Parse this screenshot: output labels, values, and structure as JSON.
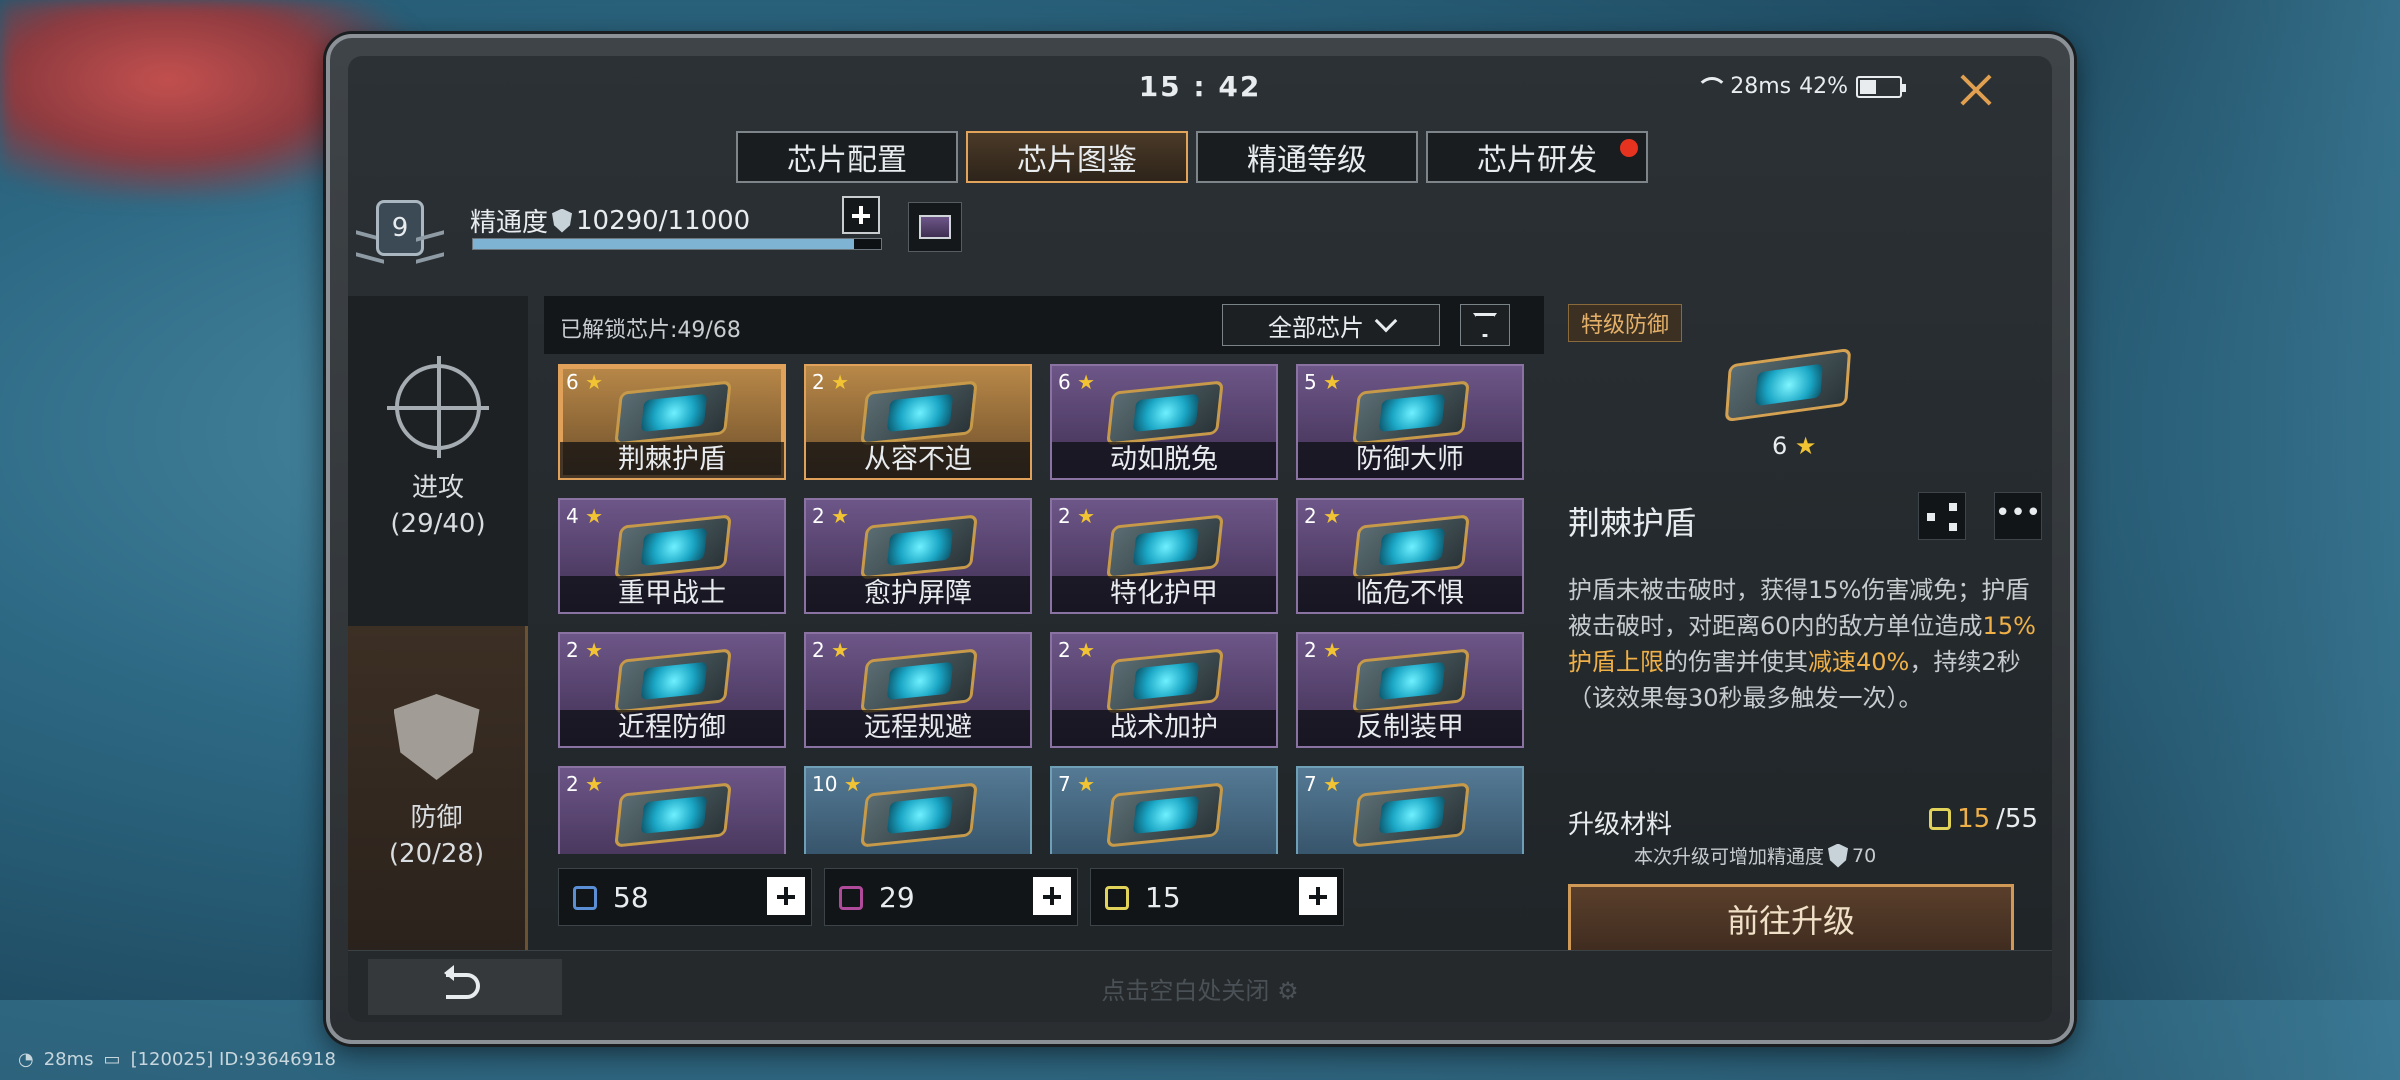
{
  "status": {
    "time": "15 : 42",
    "network": "28ms",
    "battery": "42%",
    "battery_level": 0.42
  },
  "tabs": [
    {
      "label": "芯片配置",
      "active": false,
      "badge": false
    },
    {
      "label": "芯片图鉴",
      "active": true,
      "badge": false
    },
    {
      "label": "精通等级",
      "active": false,
      "badge": false
    },
    {
      "label": "芯片研发",
      "active": false,
      "badge": true
    }
  ],
  "mastery": {
    "level": "9",
    "label": "精通度",
    "value": "10290/11000",
    "progress": 0.935
  },
  "left_nav": [
    {
      "label": "进攻",
      "count": "(29/40)",
      "icon": "crosshair-icon",
      "active": false
    },
    {
      "label": "防御",
      "count": "(20/28)",
      "icon": "shield-icon",
      "active": true
    }
  ],
  "grid": {
    "unlocked": "已解锁芯片:49/68",
    "filter": "全部芯片",
    "cards": [
      {
        "stars": "6",
        "name": "荆棘护盾",
        "rarity": "gold",
        "selected": true
      },
      {
        "stars": "2",
        "name": "从容不迫",
        "rarity": "gold",
        "selected": false
      },
      {
        "stars": "6",
        "name": "动如脱兔",
        "rarity": "purple",
        "selected": false
      },
      {
        "stars": "5",
        "name": "防御大师",
        "rarity": "purple",
        "selected": false
      },
      {
        "stars": "4",
        "name": "重甲战士",
        "rarity": "purple",
        "selected": false
      },
      {
        "stars": "2",
        "name": "愈护屏障",
        "rarity": "purple",
        "selected": false
      },
      {
        "stars": "2",
        "name": "特化护甲",
        "rarity": "purple",
        "selected": false
      },
      {
        "stars": "2",
        "name": "临危不惧",
        "rarity": "purple",
        "selected": false
      },
      {
        "stars": "2",
        "name": "近程防御",
        "rarity": "purple",
        "selected": false
      },
      {
        "stars": "2",
        "name": "远程规避",
        "rarity": "purple",
        "selected": false
      },
      {
        "stars": "2",
        "name": "战术加护",
        "rarity": "purple",
        "selected": false
      },
      {
        "stars": "2",
        "name": "反制装甲",
        "rarity": "purple",
        "selected": false
      },
      {
        "stars": "2",
        "name": "",
        "rarity": "purple",
        "selected": false
      },
      {
        "stars": "10",
        "name": "",
        "rarity": "blue",
        "selected": false
      },
      {
        "stars": "7",
        "name": "",
        "rarity": "blue",
        "selected": false
      },
      {
        "stars": "7",
        "name": "",
        "rarity": "blue",
        "selected": false
      }
    ]
  },
  "materials": [
    {
      "value": "58",
      "color": "#5a8fd6"
    },
    {
      "value": "29",
      "color": "#b04a9a"
    },
    {
      "value": "15",
      "color": "#e1d35a"
    }
  ],
  "detail": {
    "tag": "特级防御",
    "stars": "6",
    "name": "荆棘护盾",
    "desc_1": "护盾未被击破时，获得15%伤害减免；护盾被击破时，对距离60内的敌方单位造成",
    "desc_hl_1": "15%护盾上限",
    "desc_2": "的伤害并使其",
    "desc_hl_2": "减速40%",
    "desc_3": "，持续2秒（该效果每30秒最多触发一次）。",
    "upgrade_label": "升级材料",
    "upgrade_current": "15",
    "upgrade_total": "/55",
    "upgrade_hint": "本次升级可增加精通度",
    "upgrade_hint_value": "70",
    "goto_button": "前往升级"
  },
  "footer": {
    "close_hint": "点击空白处关闭"
  },
  "os_bar": {
    "ping": "28ms",
    "id": "[120025] ID:93646918"
  }
}
